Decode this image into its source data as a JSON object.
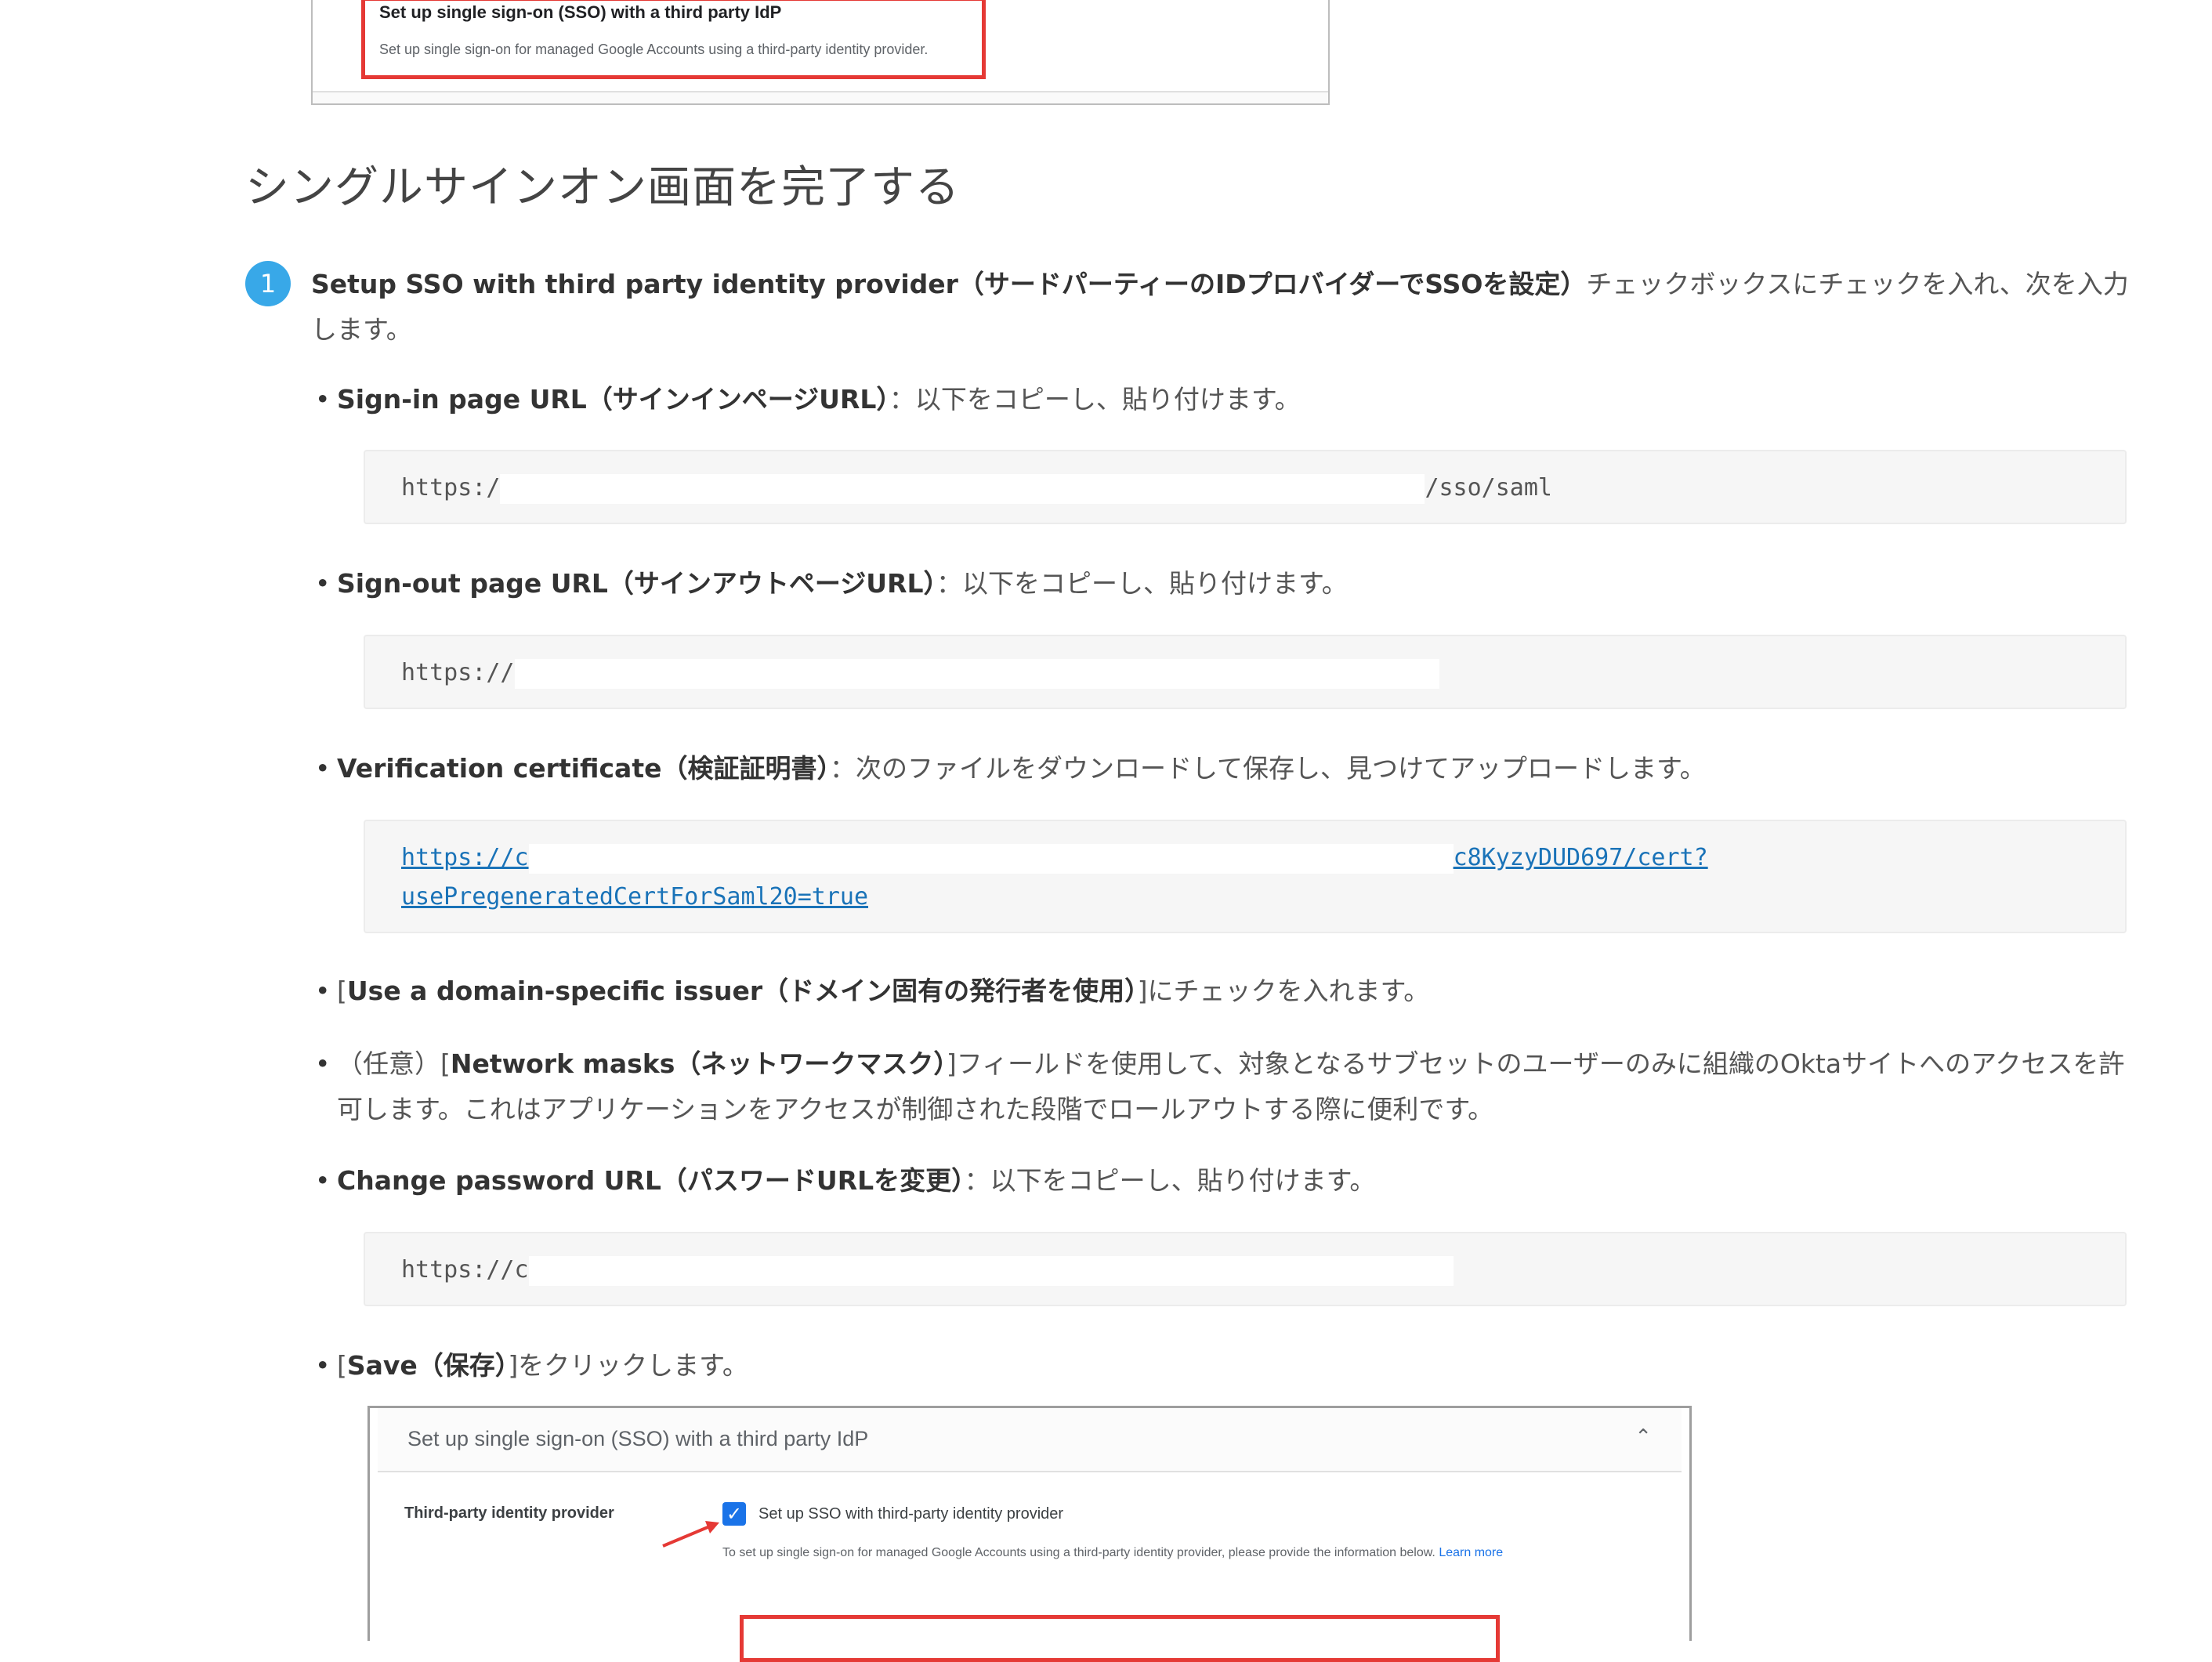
{
  "top_screenshot": {
    "title": "Set up single sign-on (SSO) with a third party IdP",
    "description": "Set up single sign-on for managed Google Accounts using a third-party identity provider."
  },
  "heading": "シングルサインオン画面を完了する",
  "step": {
    "number": "1",
    "bold": "Setup SSO with third party identity provider（サードパーティーのIDプロバイダーでSSOを設定）",
    "rest": "チェックボックスにチェックを入れ、次を入力します。"
  },
  "items": {
    "signin": {
      "bold": "Sign-in page URL（サインインページURL）",
      "rest": "：以下をコピーし、貼り付けます。",
      "code_prefix": "https:/",
      "code_suffix": "/sso/saml"
    },
    "signout": {
      "bold": "Sign-out page URL（サインアウトページURL）",
      "rest": "：以下をコピーし、貼り付けます。",
      "code_prefix": "https://"
    },
    "cert": {
      "bold": "Verification certificate（検証証明書）",
      "rest": "：次のファイルをダウンロードして保存し、見つけてアップロードします。",
      "code_prefix": "https://c",
      "code_suffix": "c8KyzyDUD697/cert?",
      "code_line2": "usePregeneratedCertForSaml20=true"
    },
    "issuer": {
      "pre": "[",
      "bold": "Use a domain-specific issuer（ドメイン固有の発行者を使用）",
      "rest": "]にチェックを入れます。"
    },
    "masks": {
      "pre": "（任意）[",
      "bold": "Network masks（ネットワークマスク）",
      "rest": "]フィールドを使用して、対象となるサブセットのユーザーのみに組織のOktaサイトへのアクセスを許可します。これはアプリケーションをアクセスが制御された段階でロールアウトする際に便利です。"
    },
    "password": {
      "bold": "Change password URL（パスワードURLを変更）",
      "rest": "：以下をコピーし、貼り付けます。",
      "code_prefix": "https://c"
    },
    "save": {
      "pre": "[",
      "bold": "Save（保存）",
      "rest": "]をクリックします。"
    }
  },
  "bottom_screenshot": {
    "title": "Set up single sign-on (SSO) with a third party IdP",
    "label": "Third-party identity provider",
    "checkbox_label": "Set up SSO with third-party identity provider",
    "description": "To set up single sign-on for managed Google Accounts using a third-party identity provider, please provide the information below.",
    "learn_more": "Learn more"
  },
  "colors": {
    "accent_blue": "#38a8e8",
    "link_blue": "#1a73b8",
    "highlight_red": "#e53935"
  }
}
